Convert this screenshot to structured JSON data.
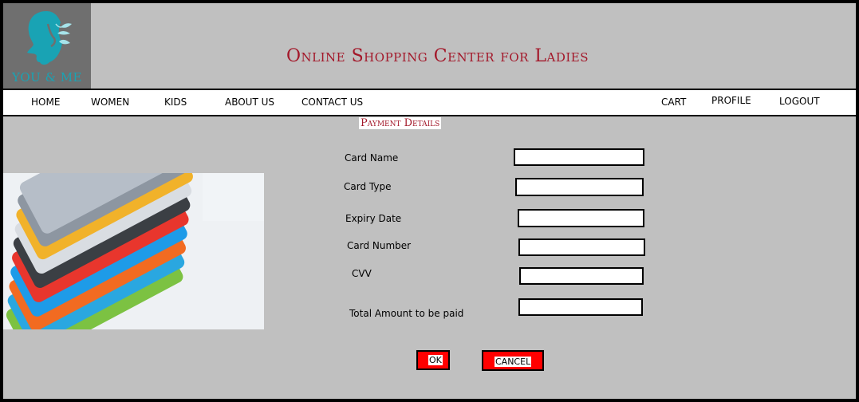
{
  "header": {
    "logo_text": "YOU & ME",
    "site_title": "Online Shopping Center for Ladies"
  },
  "nav": {
    "home": "HOME",
    "women": "WOMEN",
    "kids": "KIDS",
    "about": "ABOUT US",
    "contact": "CONTACT US",
    "cart": "CART",
    "profile": "PROFILE",
    "logout": "LOGOUT"
  },
  "payment": {
    "title": "Payment Details",
    "fields": {
      "card_name": {
        "label": "Card Name",
        "value": ""
      },
      "card_type": {
        "label": "Card Type",
        "value": ""
      },
      "expiry_date": {
        "label": "Expiry Date",
        "value": ""
      },
      "card_number": {
        "label": "Card Number",
        "value": ""
      },
      "cvv": {
        "label": "CVV",
        "value": ""
      },
      "total_amount": {
        "label": "Total Amount to be paid",
        "value": ""
      }
    },
    "ok_label": "OK",
    "cancel_label": "CANCEL"
  },
  "colors": {
    "title_red": "#a3182a",
    "logo_teal": "#19a3b4",
    "button_red": "#ff0000",
    "page_gray": "#c0c0c0"
  },
  "icons": [
    "woman-face-logo-icon",
    "credit-cards-image"
  ]
}
